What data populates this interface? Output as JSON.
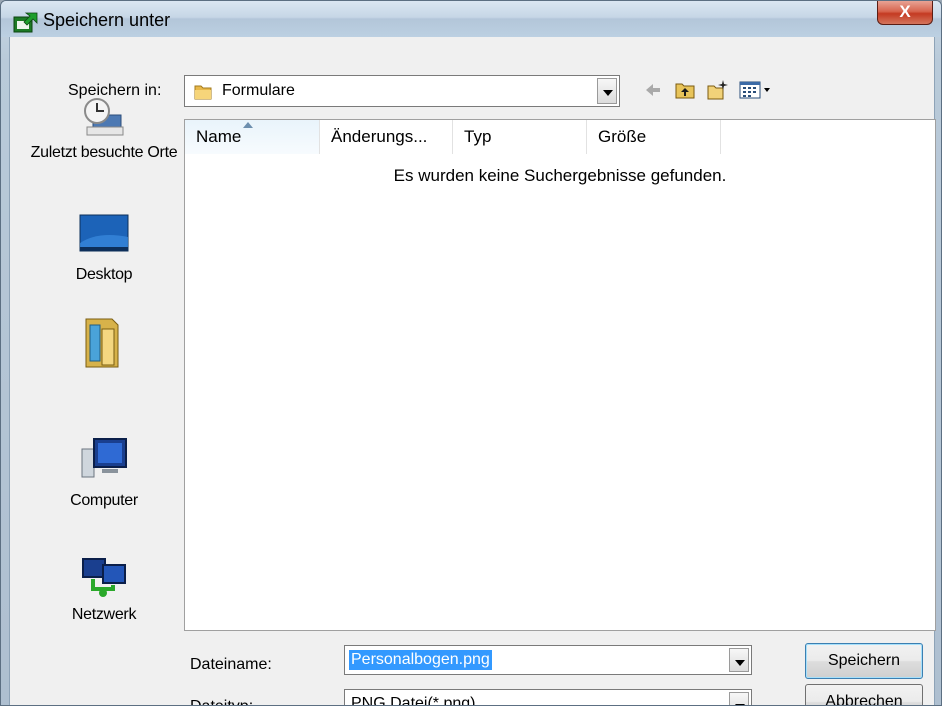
{
  "window": {
    "title": "Speichern unter",
    "close_label": "X",
    "close_icon": "close-icon"
  },
  "toolbar": {
    "save_in_label": "Speichern in:",
    "current_folder": "Formulare",
    "folder_icon": "folder-icon",
    "icons": [
      "back-arrow-icon",
      "up-folder-icon",
      "new-folder-icon",
      "view-menu-icon"
    ]
  },
  "places": [
    {
      "label": "Zuletzt besuchte Orte",
      "icon": "recent-places-icon"
    },
    {
      "label": "Desktop",
      "icon": "desktop-icon"
    },
    {
      "label": "",
      "icon": "documents-folder-icon"
    },
    {
      "label": "Computer",
      "icon": "computer-icon"
    },
    {
      "label": "Netzwerk",
      "icon": "network-icon"
    }
  ],
  "filelist": {
    "columns": [
      "Name",
      "Änderungs...",
      "Typ",
      "Größe"
    ],
    "empty_message": "Es wurden keine Suchergebnisse gefunden."
  },
  "form": {
    "filename_label": "Dateiname:",
    "filename_value": "Personalbogen.png",
    "filetype_label": "Dateityp:",
    "filetype_value": "PNG Datei(*.png)"
  },
  "buttons": {
    "save": "Speichern",
    "cancel": "Abbrechen"
  },
  "colors": {
    "selection": "#3399ff",
    "title_bar": "#c6d6e6",
    "close_button": "#c43a22"
  }
}
